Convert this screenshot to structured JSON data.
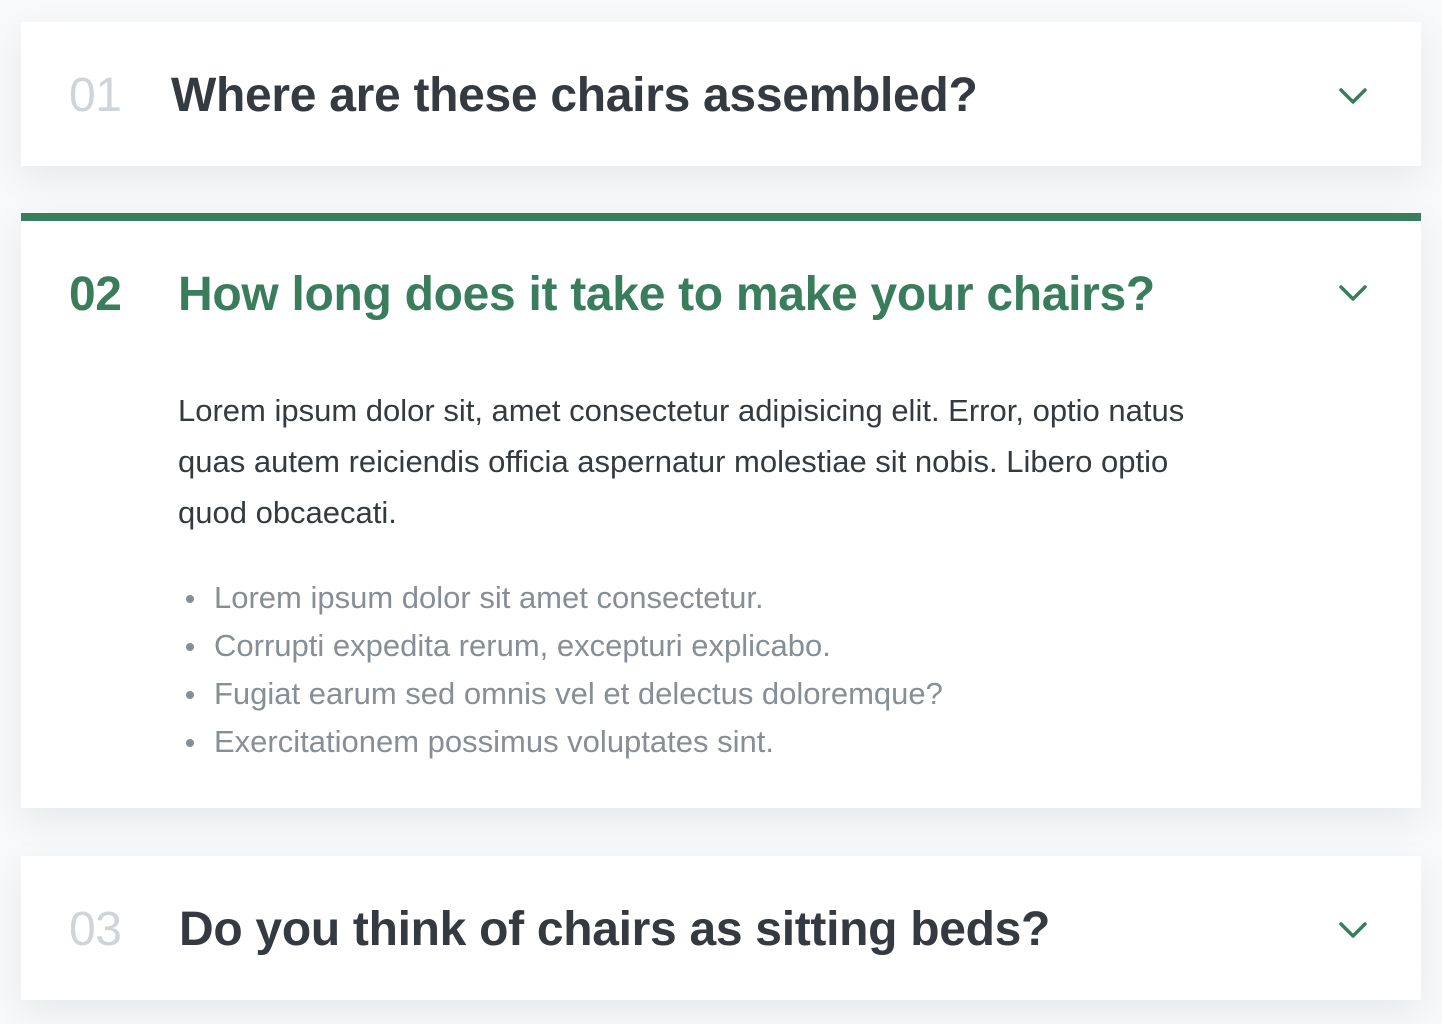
{
  "colors": {
    "accent": "#3a7d5c",
    "text_dark": "#343a40",
    "text_muted": "#868e96",
    "number_muted": "#ced4da"
  },
  "faq": [
    {
      "number": "01",
      "question": "Where are these chairs assembled?",
      "open": false
    },
    {
      "number": "02",
      "question": "How long does it take to make your chairs?",
      "open": true,
      "answer": "Lorem ipsum dolor sit, amet consectetur adipisicing elit. Error, optio natus quas autem reiciendis officia aspernatur molestiae sit nobis. Libero optio quod obcaecati.",
      "bullets": [
        "Lorem ipsum dolor sit amet consectetur.",
        "Corrupti expedita rerum, excepturi explicabo.",
        "Fugiat earum sed omnis vel et delectus doloremque?",
        "Exercitationem possimus voluptates sint."
      ]
    },
    {
      "number": "03",
      "question": "Do you think of chairs as sitting beds?",
      "open": false
    }
  ],
  "icons": {
    "toggle": "chevron-down-icon"
  }
}
